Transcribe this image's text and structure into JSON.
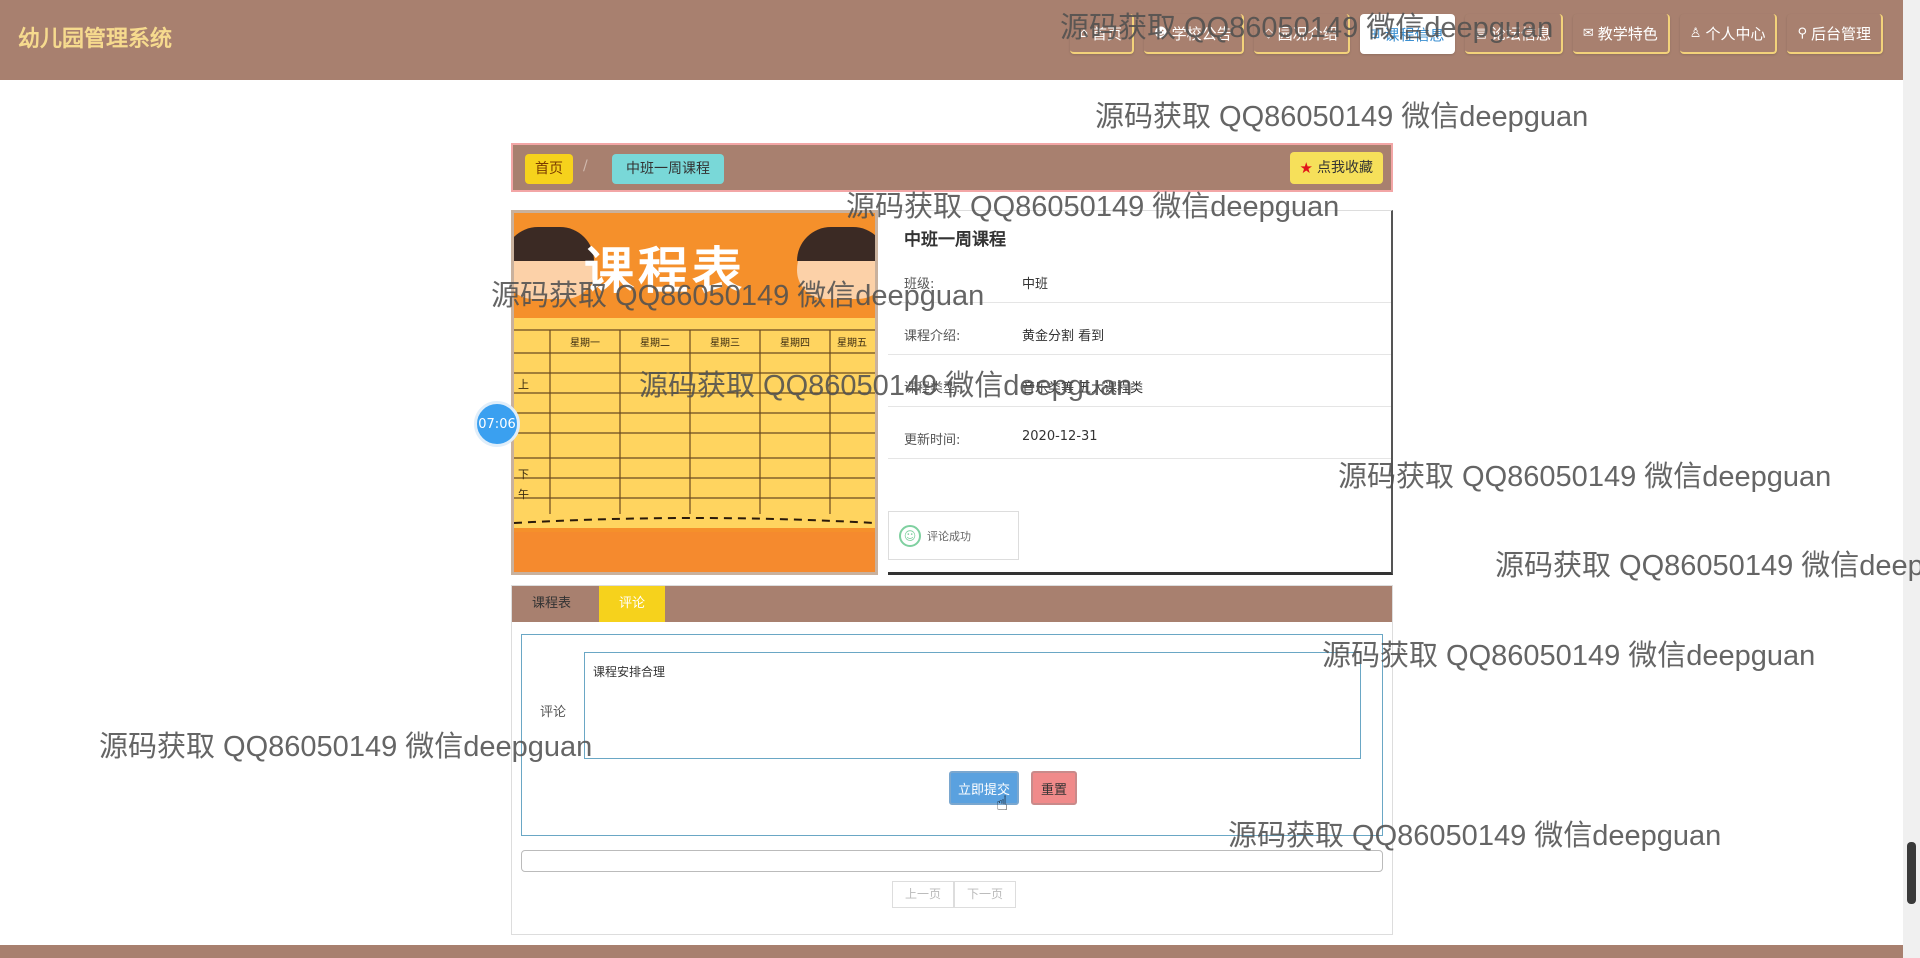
{
  "header": {
    "logo": "幼儿园管理系统",
    "nav": [
      {
        "icon": "⌂",
        "label": "首页"
      },
      {
        "icon": "☻",
        "label": "学校公告"
      },
      {
        "icon": "◇",
        "label": "园况介绍"
      },
      {
        "icon": "⊞",
        "label": "课程信息"
      },
      {
        "icon": "▤",
        "label": "论坛信息"
      },
      {
        "icon": "✉",
        "label": "教学特色"
      },
      {
        "icon": "♙",
        "label": "个人中心"
      },
      {
        "icon": "⚲",
        "label": "后台管理"
      }
    ]
  },
  "breadcrumb": {
    "home": "首页",
    "current": "中班一周课程",
    "favorite": "点我收藏"
  },
  "image": {
    "title": "课程表",
    "weekdays": [
      "星期一",
      "星期二",
      "星期三",
      "星期四",
      "星期五"
    ],
    "left_labels": [
      "上",
      "下",
      "午"
    ]
  },
  "detail": {
    "title": "中班一周课程",
    "rows": [
      {
        "label": "班级:",
        "value": "中班"
      },
      {
        "label": "课程介绍:",
        "value": "黄金分割 看到"
      },
      {
        "label": "课程类型:",
        "value": "音乐类等 五大课程类"
      },
      {
        "label": "更新时间:",
        "value": "2020-12-31"
      }
    ],
    "toast": "评论成功"
  },
  "timer": "07:06",
  "tabs": [
    "课程表",
    "评论"
  ],
  "comment_form": {
    "label": "评论",
    "text": "课程安排合理",
    "submit": "立即提交",
    "reset": "重置"
  },
  "pager": {
    "prev": "上一页",
    "next": "下一页"
  },
  "watermark": "源码获取 QQ86050149 微信deepguan"
}
